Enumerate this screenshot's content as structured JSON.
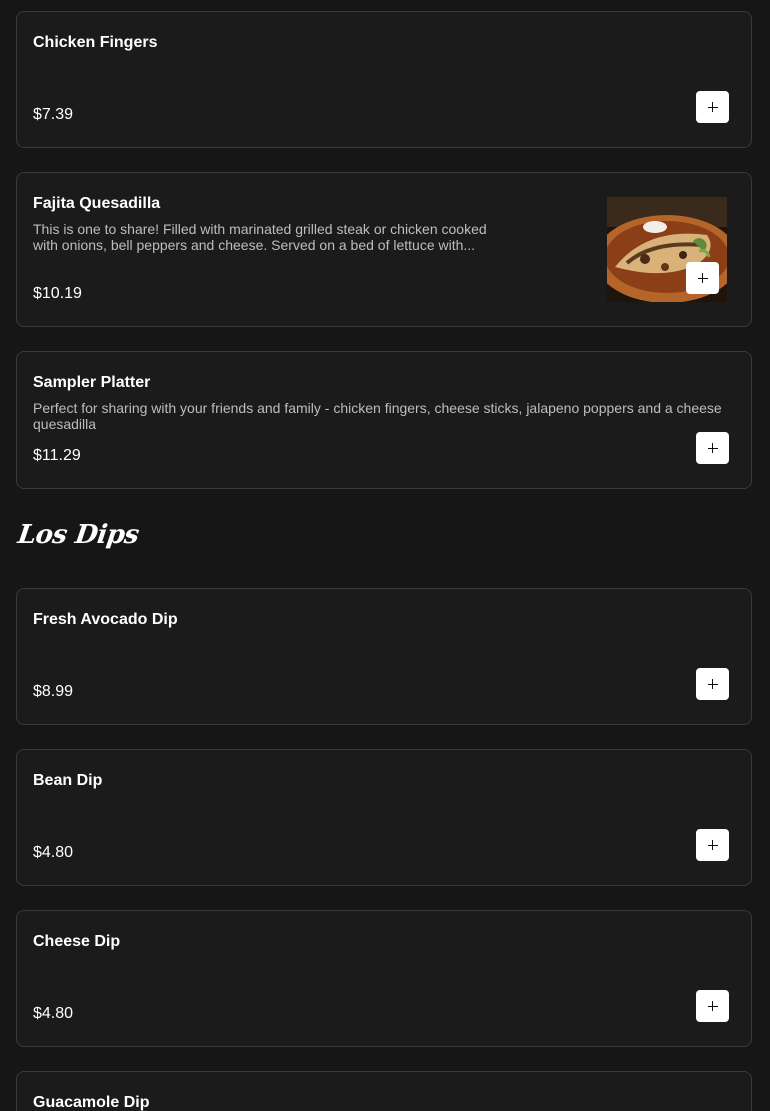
{
  "items_top": [
    {
      "name": "Chicken Fingers",
      "description": "",
      "price": "$7.39"
    },
    {
      "name": "Fajita Quesadilla",
      "description": "This is one to share! Filled with marinated grilled steak or chicken cooked with onions, bell peppers and cheese. Served on a bed of lettuce with...",
      "price": "$10.19"
    },
    {
      "name": "Sampler Platter",
      "description": "Perfect for sharing with your friends and family - chicken fingers, cheese sticks, jalapeno poppers and a cheese quesadilla",
      "price": "$11.29"
    }
  ],
  "section": {
    "title": "Los Dips"
  },
  "items_dips": [
    {
      "name": "Fresh Avocado Dip",
      "description": "",
      "price": "$8.99"
    },
    {
      "name": "Bean Dip",
      "description": "",
      "price": "$4.80"
    },
    {
      "name": "Cheese Dip",
      "description": "",
      "price": "$4.80"
    },
    {
      "name": "Guacamole Dip",
      "description": "",
      "price": ""
    }
  ],
  "icons": {
    "add": "plus-icon",
    "photo": "quesadilla-photo"
  },
  "colors": {
    "background": "#161616",
    "card": "#1b1b1b",
    "border": "#3a3a3a",
    "button": "#ffffff"
  }
}
